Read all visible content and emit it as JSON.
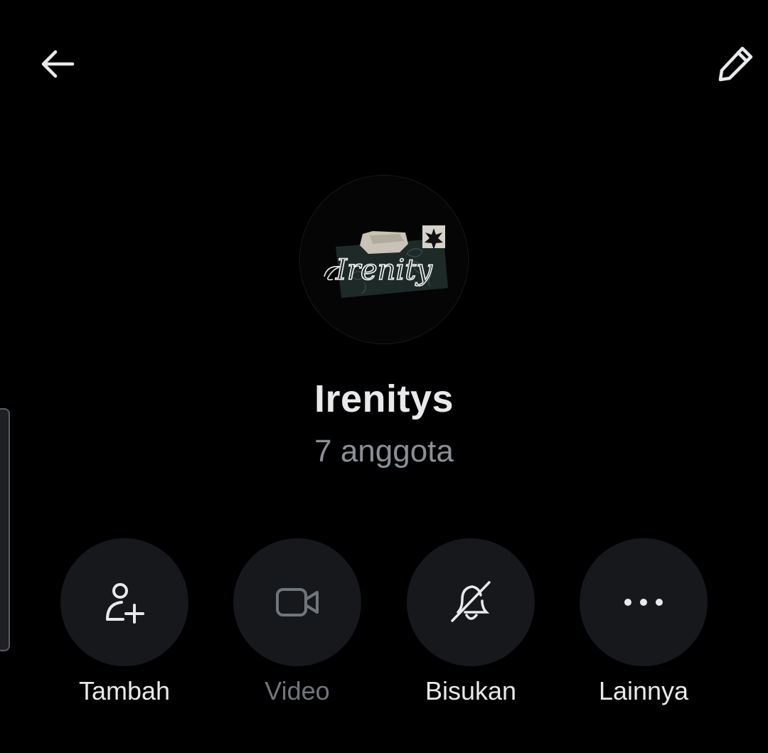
{
  "header": {
    "back_icon": "arrow-left-icon",
    "edit_icon": "pencil-icon"
  },
  "group": {
    "name": "Irenitys",
    "members": "7 anggota",
    "avatar_text": "Irenity"
  },
  "actions": [
    {
      "id": "add",
      "label": "Tambah",
      "icon": "add-person-icon",
      "enabled": true
    },
    {
      "id": "video",
      "label": "Video",
      "icon": "video-camera-icon",
      "enabled": false
    },
    {
      "id": "mute",
      "label": "Bisukan",
      "icon": "bell-off-icon",
      "enabled": true
    },
    {
      "id": "more",
      "label": "Lainnya",
      "icon": "more-horizontal-icon",
      "enabled": true
    }
  ],
  "colors": {
    "background": "#000000",
    "button_fill": "#16181c",
    "text_primary": "#e7e9ea",
    "text_secondary": "#8b9096",
    "text_disabled": "#71767b"
  }
}
